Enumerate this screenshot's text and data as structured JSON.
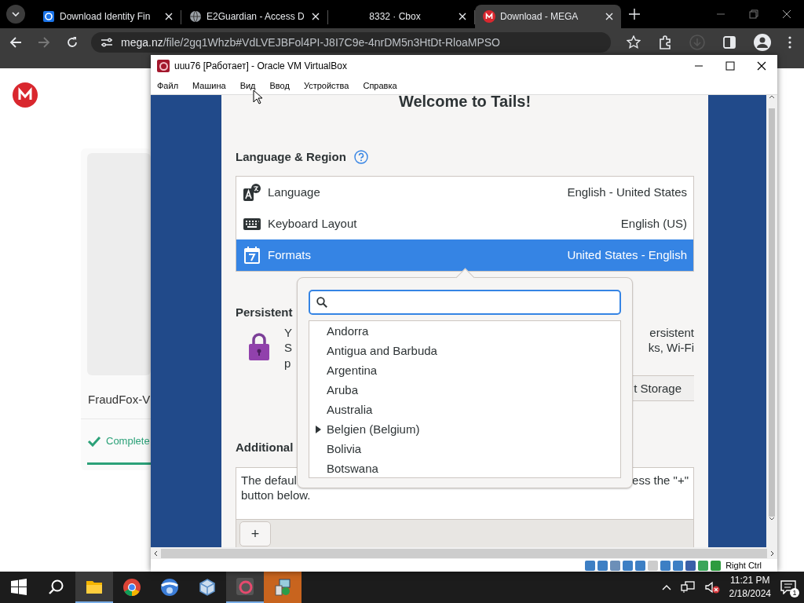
{
  "browser": {
    "tabs": [
      {
        "title": "Download Identity Fin",
        "kind": "app",
        "selected": false
      },
      {
        "title": "E2Guardian - Access D",
        "kind": "globe",
        "selected": false
      },
      {
        "title": "8332 · Cbox",
        "kind": "none",
        "selected": false
      },
      {
        "title": "Download - MEGA",
        "kind": "mega",
        "selected": true
      }
    ],
    "url_host": "mega.nz",
    "url_path": "/file/2gq1Whzb#VdLVEJBFol4PI-J8I7C9e-4nrDM5n3HtDt-RloaMPSO"
  },
  "mega_page": {
    "file_name": "FraudFox-V",
    "status": "Complete"
  },
  "virtualbox": {
    "title": "uuu76 [Работает] - Oracle VM VirtualBox",
    "menu": [
      "Файл",
      "Машина",
      "Вид",
      "Ввод",
      "Устройства",
      "Справка"
    ],
    "host_key": "Right Ctrl"
  },
  "tails": {
    "heading": "Welcome to Tails!",
    "language_region": {
      "title": "Language & Region",
      "rows": [
        {
          "kind": "language",
          "label": "Language",
          "value": "English - United States",
          "selected": false
        },
        {
          "kind": "keyboard",
          "label": "Keyboard Layout",
          "value": "English (US)",
          "selected": false
        },
        {
          "kind": "calendar",
          "label": "Formats",
          "value": "United States - English",
          "selected": true
        }
      ]
    },
    "persistent": {
      "title": "Persistent",
      "text_left": [
        "Y",
        "S",
        "p"
      ],
      "text_right": [
        "ersistent",
        "ks, Wi-Fi"
      ],
      "button": "t Storage"
    },
    "additional": {
      "title": "Additional",
      "text_left": "The defaul",
      "text_right": "ess the \"+\"",
      "text_line2": "button below.",
      "add_button": "+"
    },
    "popover": {
      "items": [
        {
          "label": "Andorra",
          "expandable": false
        },
        {
          "label": "Antigua and Barbuda",
          "expandable": false
        },
        {
          "label": "Argentina",
          "expandable": false
        },
        {
          "label": "Aruba",
          "expandable": false
        },
        {
          "label": "Australia",
          "expandable": false
        },
        {
          "label": "Belgien (Belgium)",
          "expandable": true
        },
        {
          "label": "Bolivia",
          "expandable": false
        },
        {
          "label": "Botswana",
          "expandable": false
        }
      ]
    }
  },
  "taskbar": {
    "time": "11:21 PM",
    "date": "2/18/2024",
    "notifications": "1"
  }
}
